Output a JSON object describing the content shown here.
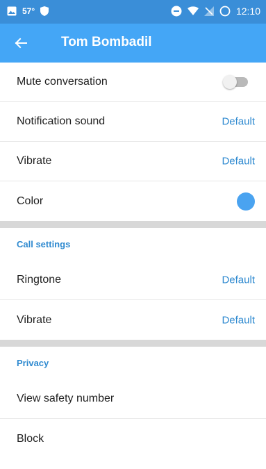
{
  "status_bar": {
    "temperature": "57°",
    "time": "12:10",
    "icons": [
      "image-icon",
      "shield-icon",
      "do-not-disturb-icon",
      "wifi-icon",
      "no-signal-icon",
      "battery-icon"
    ]
  },
  "toolbar": {
    "back_icon": "arrow-left-icon",
    "title": "Tom Bombadil"
  },
  "general": {
    "mute_label": "Mute conversation",
    "mute_on": false,
    "notification_sound_label": "Notification sound",
    "notification_sound_value": "Default",
    "vibrate_label": "Vibrate",
    "vibrate_value": "Default",
    "color_label": "Color",
    "color_value": "#4aa3f0"
  },
  "call_settings": {
    "header": "Call settings",
    "ringtone_label": "Ringtone",
    "ringtone_value": "Default",
    "vibrate_label": "Vibrate",
    "vibrate_value": "Default"
  },
  "privacy": {
    "header": "Privacy",
    "safety_number_label": "View safety number",
    "block_label": "Block"
  },
  "colors": {
    "status_bar": "#3a8ed8",
    "toolbar": "#44a6f6",
    "accent_text": "#2f8ad0"
  }
}
